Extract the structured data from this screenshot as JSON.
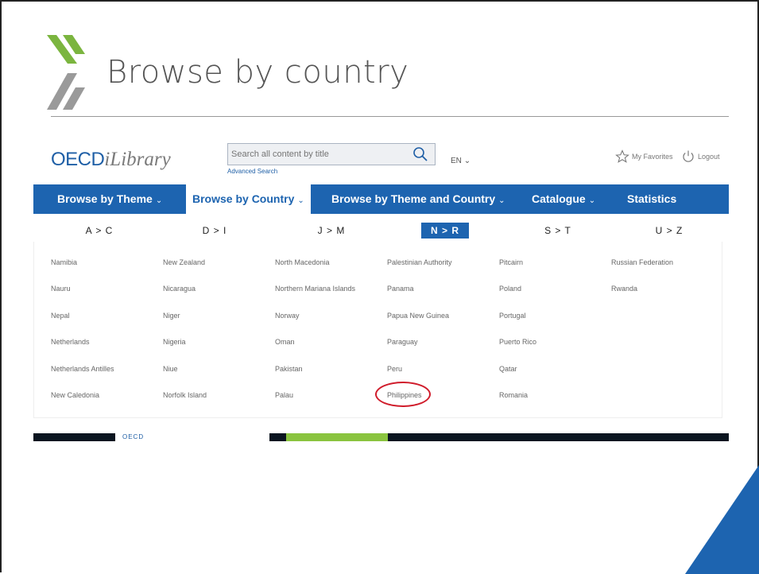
{
  "slide": {
    "title": "Browse by country",
    "accent_colors": [
      "#7bb53f",
      "#9a9a9a",
      "#1d64b0"
    ]
  },
  "header": {
    "logo_primary": "OECD",
    "logo_secondary": "iLibrary",
    "search_placeholder": "Search all content by title",
    "advanced_search": "Advanced Search",
    "language": "EN",
    "favorites": "My Favorites",
    "logout": "Logout"
  },
  "nav": {
    "items": [
      {
        "label": "Browse by Theme"
      },
      {
        "label": "Browse by Country"
      },
      {
        "label": "Browse by Theme and Country"
      },
      {
        "label": "Catalogue"
      },
      {
        "label": "Statistics"
      }
    ],
    "active": "Browse by Country"
  },
  "letters": {
    "tabs": [
      "A > C",
      "D > I",
      "J > M",
      "N > R",
      "S > T",
      "U > Z"
    ],
    "active": "N > R"
  },
  "countries": {
    "columns": [
      [
        "Namibia",
        "Nauru",
        "Nepal",
        "Netherlands",
        "Netherlands Antilles",
        "New Caledonia"
      ],
      [
        "New Zealand",
        "Nicaragua",
        "Niger",
        "Nigeria",
        "Niue",
        "Norfolk Island"
      ],
      [
        "North Macedonia",
        "Northern Mariana Islands",
        "Norway",
        "Oman",
        "Pakistan",
        "Palau"
      ],
      [
        "Palestinian Authority",
        "Panama",
        "Papua New Guinea",
        "Paraguay",
        "Peru",
        "Philippines"
      ],
      [
        "Pitcairn",
        "Poland",
        "Portugal",
        "Puerto Rico",
        "Qatar",
        "Romania"
      ],
      [
        "Russian Federation",
        "Rwanda"
      ]
    ],
    "highlighted": "Philippines",
    "highlight_color": "#d01c2b"
  },
  "banner": {
    "logo_text": "OECD"
  }
}
